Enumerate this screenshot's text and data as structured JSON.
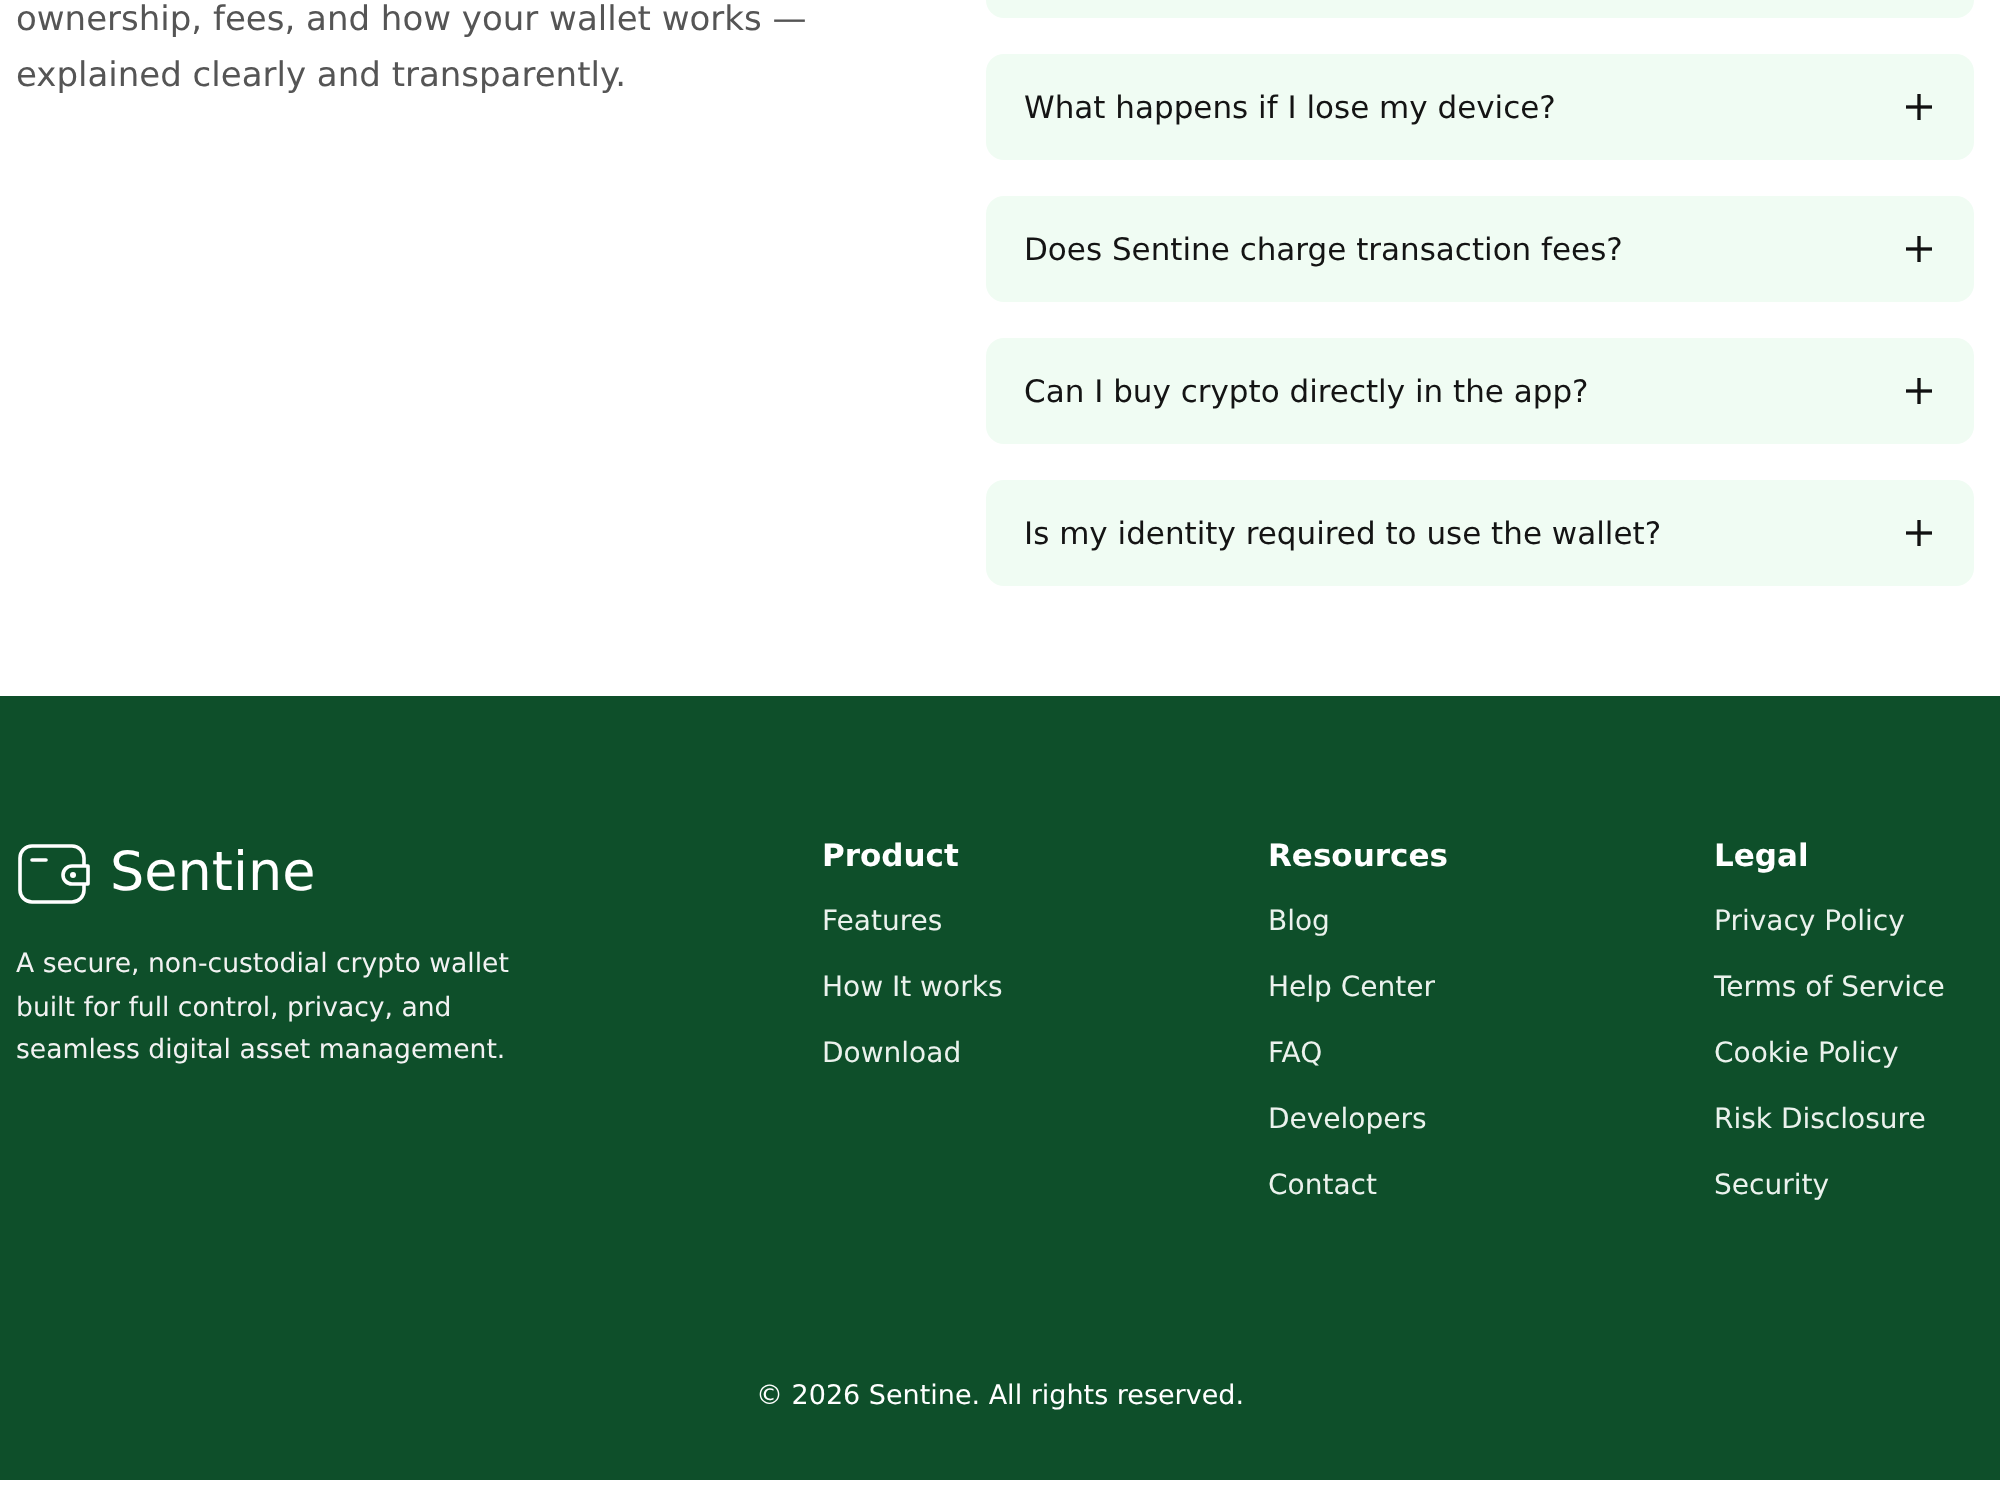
{
  "intro": {
    "lines": [
      "ownership, fees, and how your wallet works —",
      "explained clearly and transparently."
    ]
  },
  "faq": {
    "items": [
      {
        "question": "What happens if I lose my device?",
        "expanded": false
      },
      {
        "question": "Does Sentine charge transaction fees?",
        "expanded": false
      },
      {
        "question": "Can I buy crypto directly in the app?",
        "expanded": false
      },
      {
        "question": "Is my identity required to use the wallet?",
        "expanded": false
      }
    ]
  },
  "footer": {
    "brand": {
      "name": "Sentine",
      "description": "A secure, non-custodial crypto wallet built for full control, privacy, and seamless digital asset management."
    },
    "columns": [
      {
        "heading": "Product",
        "links": [
          "Features",
          "How It works",
          "Download"
        ]
      },
      {
        "heading": "Resources",
        "links": [
          "Blog",
          "Help Center",
          "FAQ",
          "Developers",
          "Contact"
        ]
      },
      {
        "heading": "Legal",
        "links": [
          "Privacy Policy",
          "Terms of Service",
          "Cookie Policy",
          "Risk Disclosure",
          "Security"
        ]
      }
    ],
    "copyright": "© 2026 Sentine. All rights reserved."
  }
}
